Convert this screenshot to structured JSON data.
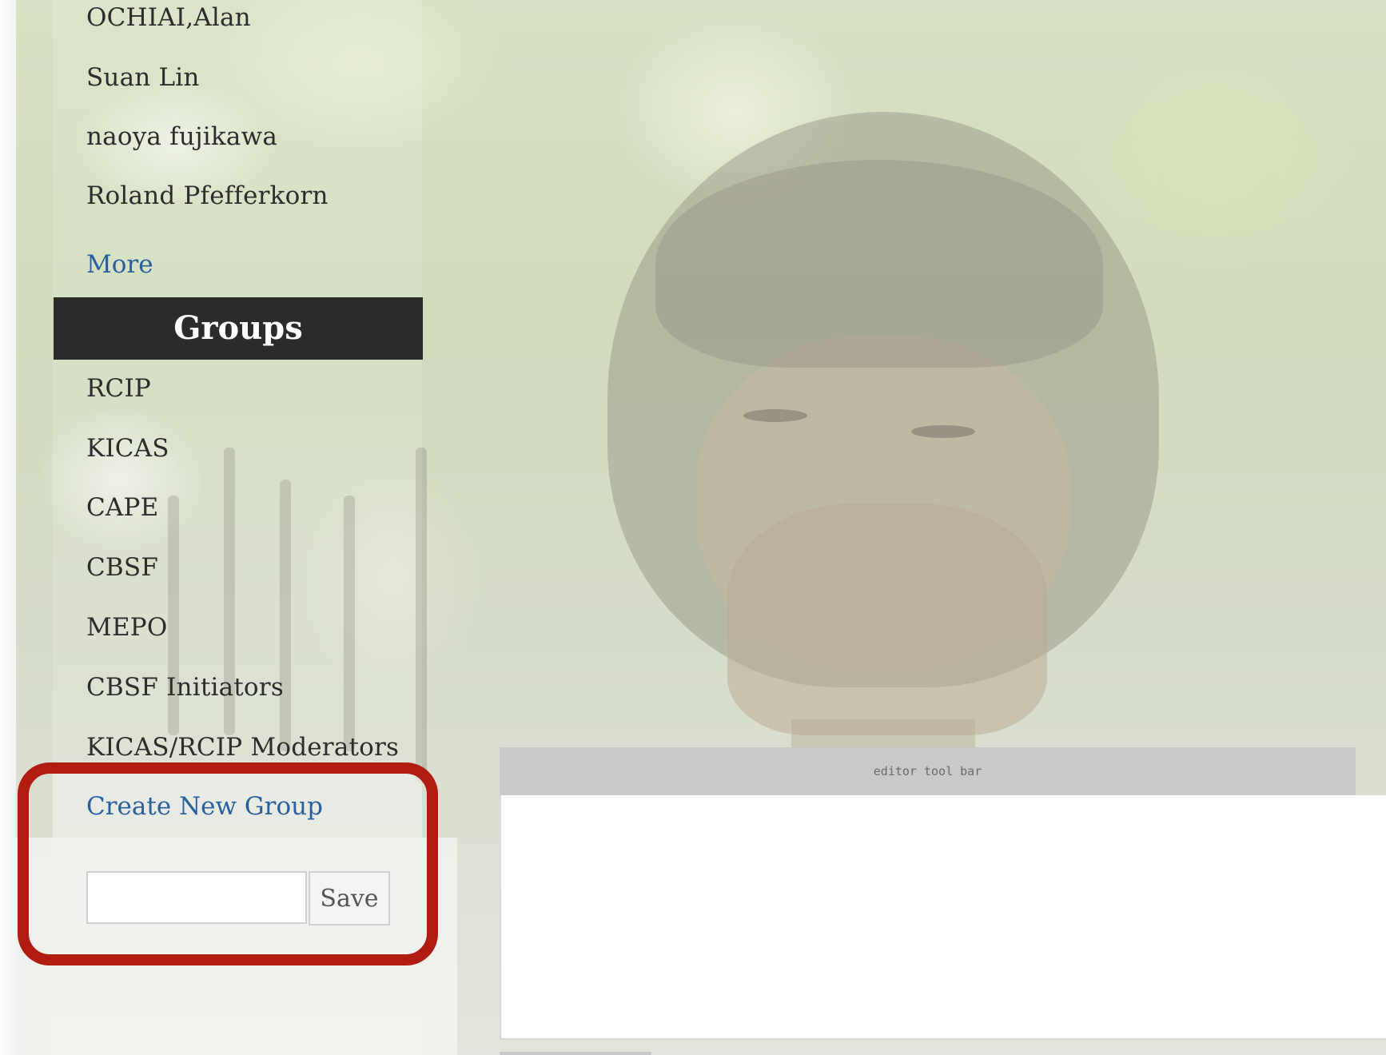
{
  "sidebar": {
    "people": [
      {
        "label": "OCHIAI,Alan"
      },
      {
        "label": "Suan Lin"
      },
      {
        "label": "naoya fujikawa"
      },
      {
        "label": "Roland Pfefferkorn"
      }
    ],
    "more_label": "More",
    "groups_header": "Groups",
    "groups": [
      {
        "label": "RCIP"
      },
      {
        "label": "KICAS"
      },
      {
        "label": "CAPE"
      },
      {
        "label": "CBSF"
      },
      {
        "label": "MEPO"
      },
      {
        "label": "CBSF Initiators"
      },
      {
        "label": "KICAS/RCIP Moderators"
      }
    ],
    "create_group_label": "Create New Group",
    "new_group_input_value": "",
    "save_label": "Save"
  },
  "editor": {
    "toolbar_label": "editor tool bar"
  },
  "colors": {
    "header_bg": "#2b2b2b",
    "link": "#2a5f9e",
    "highlight": "#b01c12"
  }
}
